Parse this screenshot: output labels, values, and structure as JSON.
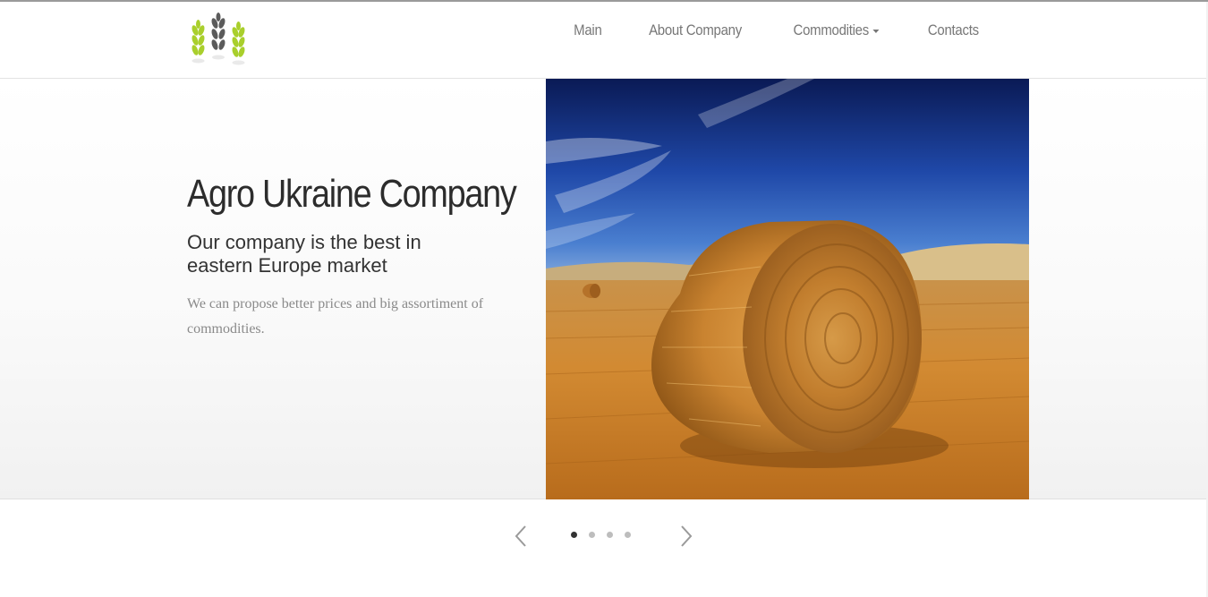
{
  "nav": {
    "items": [
      {
        "label": "Main"
      },
      {
        "label": "About Company"
      },
      {
        "label": "Commodities",
        "dropdown": true
      },
      {
        "label": "Contacts"
      }
    ]
  },
  "hero": {
    "title": "Agro Ukraine Company",
    "subtitle": "Our company is the best in eastern Europe market",
    "text": "We can propose better prices and big assortiment of commodities."
  },
  "carousel": {
    "slide_count": 4,
    "active_index": 0,
    "prev_icon": "chevron-left-icon",
    "next_icon": "chevron-right-icon"
  },
  "colors": {
    "logo_green": "#a9cf2c",
    "logo_gray": "#5b5b5b",
    "sky_top": "#0c1f62",
    "sky_bottom": "#3a6fc8",
    "straw": "#d08a2f"
  }
}
